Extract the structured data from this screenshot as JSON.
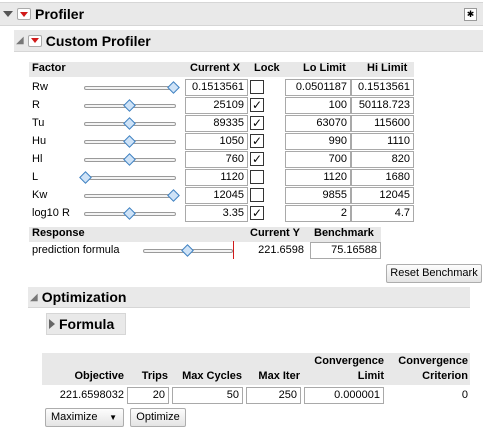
{
  "profiler": {
    "title": "Profiler"
  },
  "custom_profiler": {
    "title": "Custom Profiler"
  },
  "factor_table": {
    "headers": {
      "factor": "Factor",
      "current_x": "Current X",
      "lock": "Lock",
      "lo_limit": "Lo Limit",
      "hi_limit": "Hi Limit"
    },
    "rows": [
      {
        "name": "Rw",
        "current_x": "0.1513561",
        "locked": false,
        "lo": "0.0501187",
        "hi": "0.1513561",
        "slider": 1.0
      },
      {
        "name": "R",
        "current_x": "25109",
        "locked": true,
        "lo": "100",
        "hi": "50118.723",
        "slider": 0.5
      },
      {
        "name": "Tu",
        "current_x": "89335",
        "locked": true,
        "lo": "63070",
        "hi": "115600",
        "slider": 0.5
      },
      {
        "name": "Hu",
        "current_x": "1050",
        "locked": true,
        "lo": "990",
        "hi": "1110",
        "slider": 0.5
      },
      {
        "name": "Hl",
        "current_x": "760",
        "locked": true,
        "lo": "700",
        "hi": "820",
        "slider": 0.5
      },
      {
        "name": "L",
        "current_x": "1120",
        "locked": false,
        "lo": "1120",
        "hi": "1680",
        "slider": 0.0
      },
      {
        "name": "Kw",
        "current_x": "12045",
        "locked": false,
        "lo": "9855",
        "hi": "12045",
        "slider": 1.0
      },
      {
        "name": "log10 R",
        "current_x": "3.35",
        "locked": true,
        "lo": "2",
        "hi": "4.7",
        "slider": 0.5
      }
    ]
  },
  "response_table": {
    "headers": {
      "response": "Response",
      "current_y": "Current Y",
      "benchmark": "Benchmark"
    },
    "rows": [
      {
        "name": "prediction formula",
        "current_y": "221.6598",
        "benchmark": "75.16588",
        "slider": 0.5
      }
    ],
    "reset_button": "Reset Benchmark"
  },
  "optimization": {
    "title": "Optimization",
    "formula_title": "Formula",
    "headers": {
      "objective": "Objective",
      "trips": "Trips",
      "max_cycles": "Max Cycles",
      "max_iter": "Max Iter",
      "convergence_limit_1": "Convergence",
      "convergence_limit_2": "Limit",
      "convergence_criterion_1": "Convergence",
      "convergence_criterion_2": "Criterion"
    },
    "values": {
      "objective": "221.6598032",
      "trips": "20",
      "max_cycles": "50",
      "max_iter": "250",
      "convergence_limit": "0.000001",
      "convergence_criterion": "0"
    },
    "maximize_label": "Maximize",
    "optimize_label": "Optimize"
  },
  "colors": {
    "accent_red": "#d11a1a",
    "slider_blue": "#3c7fc0"
  }
}
